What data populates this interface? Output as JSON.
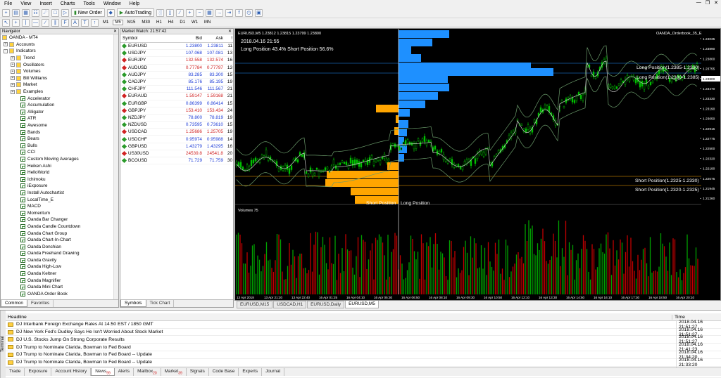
{
  "menu": [
    "File",
    "View",
    "Insert",
    "Charts",
    "Tools",
    "Window",
    "Help"
  ],
  "toolbar": {
    "new_order": "New Order",
    "autotrading": "AutoTrading"
  },
  "timeframes": [
    "M1",
    "M5",
    "M15",
    "M30",
    "H1",
    "H4",
    "D1",
    "W1",
    "MN"
  ],
  "active_timeframe": "M5",
  "navigator": {
    "title": "Navigator",
    "root": "OANDA - MT4",
    "folders": [
      "Accounts",
      "Indicators"
    ],
    "indicator_groups": [
      "Trend",
      "Oscillators",
      "Volumes",
      "Bill Williams",
      "Market",
      "Examples"
    ],
    "indicators": [
      "Accelerator",
      "Accumulation",
      "Alligator",
      "ATR",
      "Awesome",
      "Bands",
      "Bears",
      "Bulls",
      "CCI",
      "Custom Moving Averages",
      "Heiken Ashi",
      "HelloWorld",
      "Ichimoku",
      "iExposure",
      "Install Autochartist",
      "LocalTime_E",
      "MACD",
      "Momentum",
      "Oanda Bar Changer",
      "Oanda Candle Countdown",
      "Oanda Chart Group",
      "Oanda Chart-In-Chart",
      "Oanda Donchian",
      "Oanda Freehand Drawing",
      "Oanda Gravity",
      "Oanda High-Low",
      "Oanda Keltner",
      "Oanda Magnifier",
      "Oanda Mini Chart",
      "OANDA Order Book"
    ],
    "tabs": [
      "Common",
      "Favorites"
    ]
  },
  "market_watch": {
    "title": "Market Watch: 21:57:42",
    "columns": [
      "Symbol",
      "Bid",
      "Ask",
      "!"
    ],
    "rows": [
      {
        "symbol": "EURUSD",
        "bid": "1.23800",
        "ask": "1.23811",
        "spread": "11",
        "dir": "up"
      },
      {
        "symbol": "USDJPY",
        "bid": "107.068",
        "ask": "107.081",
        "spread": "13",
        "dir": "up"
      },
      {
        "symbol": "EURJPY",
        "bid": "132.558",
        "ask": "132.574",
        "spread": "16",
        "dir": "down"
      },
      {
        "symbol": "AUDUSD",
        "bid": "0.77784",
        "ask": "0.77797",
        "spread": "13",
        "dir": "down"
      },
      {
        "symbol": "AUDJPY",
        "bid": "83.285",
        "ask": "83.300",
        "spread": "15",
        "dir": "up"
      },
      {
        "symbol": "CADJPY",
        "bid": "85.176",
        "ask": "85.195",
        "spread": "19",
        "dir": "up"
      },
      {
        "symbol": "CHFJPY",
        "bid": "111.546",
        "ask": "111.567",
        "spread": "21",
        "dir": "up"
      },
      {
        "symbol": "EURAUD",
        "bid": "1.59147",
        "ask": "1.59168",
        "spread": "21",
        "dir": "down"
      },
      {
        "symbol": "EURGBP",
        "bid": "0.86399",
        "ask": "0.86414",
        "spread": "15",
        "dir": "up"
      },
      {
        "symbol": "GBPJPY",
        "bid": "153.410",
        "ask": "153.434",
        "spread": "24",
        "dir": "down"
      },
      {
        "symbol": "NZDJPY",
        "bid": "78.800",
        "ask": "78.819",
        "spread": "19",
        "dir": "up"
      },
      {
        "symbol": "NZDUSD",
        "bid": "0.73595",
        "ask": "0.73610",
        "spread": "15",
        "dir": "up"
      },
      {
        "symbol": "USDCAD",
        "bid": "1.25686",
        "ask": "1.25705",
        "spread": "19",
        "dir": "down"
      },
      {
        "symbol": "USDCHF",
        "bid": "0.95974",
        "ask": "0.95988",
        "spread": "14",
        "dir": "up"
      },
      {
        "symbol": "GBPUSD",
        "bid": "1.43279",
        "ask": "1.43295",
        "spread": "16",
        "dir": "up"
      },
      {
        "symbol": "US30USD",
        "bid": "24539.8",
        "ask": "24541.8",
        "spread": "20",
        "dir": "down"
      },
      {
        "symbol": "BCOUSD",
        "bid": "71.729",
        "ask": "71.759",
        "spread": "30",
        "dir": "up"
      }
    ],
    "tabs": [
      "Symbols",
      "Tick Chart"
    ]
  },
  "chart": {
    "header": "EURUSD,M5  1.23812 1.23815 1.23799 1.23800",
    "indicator_name": "OANDA_Orderbook_35_E",
    "datetime": "2018.04.16 21:55",
    "position_summary": "Long Position 43.4% Short Position 56.6%",
    "long_label_1": "Long Position(1.2385-1.2390)",
    "long_label_2": "Long Position(1.2380-1.2385)",
    "short_label_1": "Short Position(1.2325-1.2330)",
    "short_label_2": "Short Position(1.2320-1.2325)",
    "bottom_short": "Short Position",
    "bottom_long": "Long Position",
    "volumes_label": "Volumes 75",
    "price_ticks": [
      "1.24035",
      "1.23890",
      "1.23800",
      "1.23755",
      "1.23610",
      "1.23470",
      "1.23330",
      "1.23190",
      "1.23050",
      "1.22915",
      "1.22775",
      "1.22500",
      "1.22320",
      "1.22190",
      "1.22075",
      "1.21945",
      "1.21260"
    ],
    "current_price": "1.23800",
    "time_ticks": [
      "13 Apr 2018",
      "13 Apr 21:20",
      "13 Apr 22:40",
      "16 Apr 01:25",
      "16 Apr 04:10",
      "16 Apr 05:30",
      "16 Apr 06:50",
      "16 Apr 08:10",
      "16 Apr 09:30",
      "16 Apr 10:50",
      "16 Apr 12:10",
      "16 Apr 13:30",
      "16 Apr 14:50",
      "16 Apr 16:10",
      "16 Apr 17:30",
      "16 Apr 18:50",
      "16 Apr 20:10"
    ],
    "tabs": [
      "EURUSD,M15",
      "USDCAD,H1",
      "EURUSD,Daily",
      "EURUSD,M5"
    ],
    "colors": {
      "long": "#1e90ff",
      "short": "#ffa500",
      "candle": "#00c000",
      "vol_up": "#00a000",
      "vol_down": "#c00000"
    }
  },
  "terminal": {
    "side_label": "Terminal",
    "columns": [
      "Headline",
      "Time"
    ],
    "rows": [
      {
        "source": "DJ",
        "headline": "Interbank Foreign Exchange Rates At 14:50 EST / 1850 GMT",
        "time": "2018.04.16 21:51:27"
      },
      {
        "source": "DJ",
        "headline": "New York Fed's Dudley Says He Isn't Worried About Stock Market",
        "time": "2018.04.16 21:51:27"
      },
      {
        "source": "DJ",
        "headline": "U.S. Stocks Jump On Strong Corporate Results",
        "time": "2018.04.16 21:51:27"
      },
      {
        "source": "DJ",
        "headline": "Trump to Nominate Clarida, Bowman to Fed Board",
        "time": "2018.04.16 21:41:23"
      },
      {
        "source": "DJ",
        "headline": "Trump to Nominate Clarida, Bowman to Fed Board -- Update",
        "time": "2018.04.16 21:34:20"
      },
      {
        "source": "DJ",
        "headline": "Trump to Nominate Clarida, Bowman to Fed Board -- Update",
        "time": "2018.04.16 21:33:20"
      }
    ],
    "tabs": [
      {
        "label": "Trade",
        "badge": ""
      },
      {
        "label": "Exposure",
        "badge": ""
      },
      {
        "label": "Account History",
        "badge": ""
      },
      {
        "label": "News",
        "badge": "99"
      },
      {
        "label": "Alerts",
        "badge": ""
      },
      {
        "label": "Mailbox",
        "badge": "20"
      },
      {
        "label": "Market",
        "badge": "39"
      },
      {
        "label": "Signals",
        "badge": ""
      },
      {
        "label": "Code Base",
        "badge": ""
      },
      {
        "label": "Experts",
        "badge": ""
      },
      {
        "label": "Journal",
        "badge": ""
      }
    ],
    "active_tab": "News"
  }
}
